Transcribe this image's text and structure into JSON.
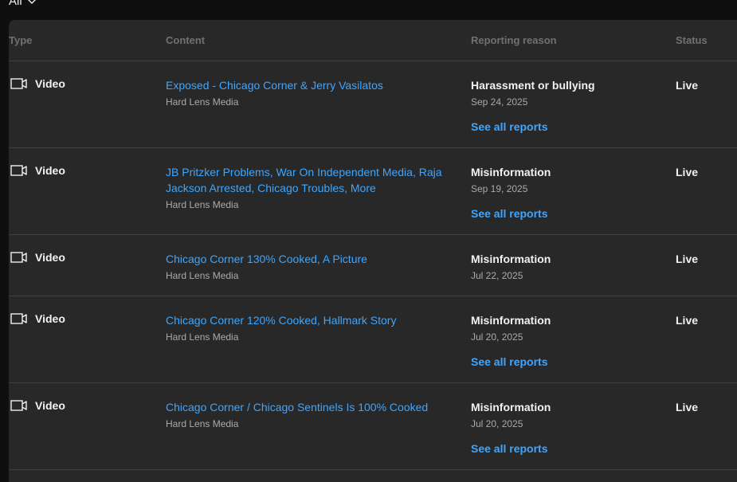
{
  "filter": {
    "label": "All",
    "icon": "chevron-down-icon"
  },
  "table": {
    "columns": {
      "type": "Type",
      "content": "Content",
      "reason": "Reporting reason",
      "status": "Status"
    },
    "rows": [
      {
        "type": "Video",
        "type_icon": "video-icon",
        "title": "Exposed - Chicago Corner & Jerry Vasilatos",
        "channel": "Hard Lens Media",
        "reason": "Harassment or bullying",
        "date": "Sep 24, 2025",
        "see_all": "See all reports",
        "status": "Live"
      },
      {
        "type": "Video",
        "type_icon": "video-icon",
        "title": "JB Pritzker Problems, War On Independent Media, Raja Jackson Arrested, Chicago Troubles, More",
        "channel": "Hard Lens Media",
        "reason": "Misinformation",
        "date": "Sep 19, 2025",
        "see_all": "See all reports",
        "status": "Live"
      },
      {
        "type": "Video",
        "type_icon": "video-icon",
        "title": "Chicago Corner 130% Cooked, A Picture",
        "channel": "Hard Lens Media",
        "reason": "Misinformation",
        "date": "Jul 22, 2025",
        "see_all": "",
        "status": "Live"
      },
      {
        "type": "Video",
        "type_icon": "video-icon",
        "title": "Chicago Corner 120% Cooked, Hallmark Story",
        "channel": "Hard Lens Media",
        "reason": "Misinformation",
        "date": "Jul 20, 2025",
        "see_all": "See all reports",
        "status": "Live"
      },
      {
        "type": "Video",
        "type_icon": "video-icon",
        "title": "Chicago Corner / Chicago Sentinels Is 100% Cooked",
        "channel": "Hard Lens Media",
        "reason": "Misinformation",
        "date": "Jul 20, 2025",
        "see_all": "See all reports",
        "status": "Live"
      }
    ]
  },
  "colors": {
    "background": "#0f0f0f",
    "panel": "#282828",
    "link": "#3ea6ff",
    "muted": "#aaaaaa",
    "header_text": "#717171"
  }
}
